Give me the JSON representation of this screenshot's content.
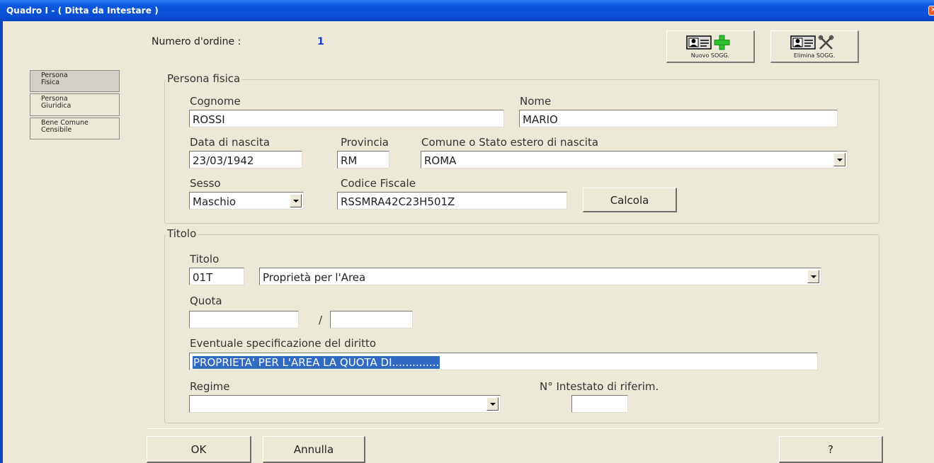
{
  "window": {
    "title": "Quadro I - ( Ditta da Intestare )"
  },
  "header": {
    "numero_label": "Numero d'ordine :",
    "numero_value": "1"
  },
  "toolbar": {
    "nuovo_label": "Nuovo SOGG.",
    "elimina_label": "Elimina SOGG."
  },
  "side_tabs": [
    {
      "line1": "Persona",
      "line2": "Fisica"
    },
    {
      "line1": "Persona",
      "line2": "Giuridica"
    },
    {
      "line1": "Bene Comune",
      "line2": "Censibile"
    }
  ],
  "persona_fisica": {
    "legend": "Persona fisica",
    "cognome_label": "Cognome",
    "cognome_value": "ROSSI",
    "nome_label": "Nome",
    "nome_value": "MARIO",
    "data_label": "Data di nascita",
    "data_value": "23/03/1942",
    "provincia_label": "Provincia",
    "provincia_value": "RM",
    "comune_label": "Comune o Stato estero di nascita",
    "comune_value": "ROMA",
    "sesso_label": "Sesso",
    "sesso_value": "Maschio",
    "cf_label": "Codice Fiscale",
    "cf_value": "RSSMRA42C23H501Z",
    "calcola_label": "Calcola"
  },
  "titolo": {
    "legend": "Titolo",
    "titolo_label": "Titolo",
    "codice_value": "01T",
    "descr_value": "Proprietà per l'Area",
    "quota_label": "Quota",
    "quota_num": "",
    "quota_sep": "/",
    "quota_den": "",
    "spec_label": "Eventuale specificazione del diritto",
    "spec_value": "PROPRIETA' PER L'AREA LA QUOTA DI..............",
    "regime_label": "Regime",
    "regime_value": "",
    "intestato_label": "N° Intestato di riferim.",
    "intestato_value": ""
  },
  "footer": {
    "ok_label": "OK",
    "annulla_label": "Annulla",
    "help_label": "?"
  }
}
